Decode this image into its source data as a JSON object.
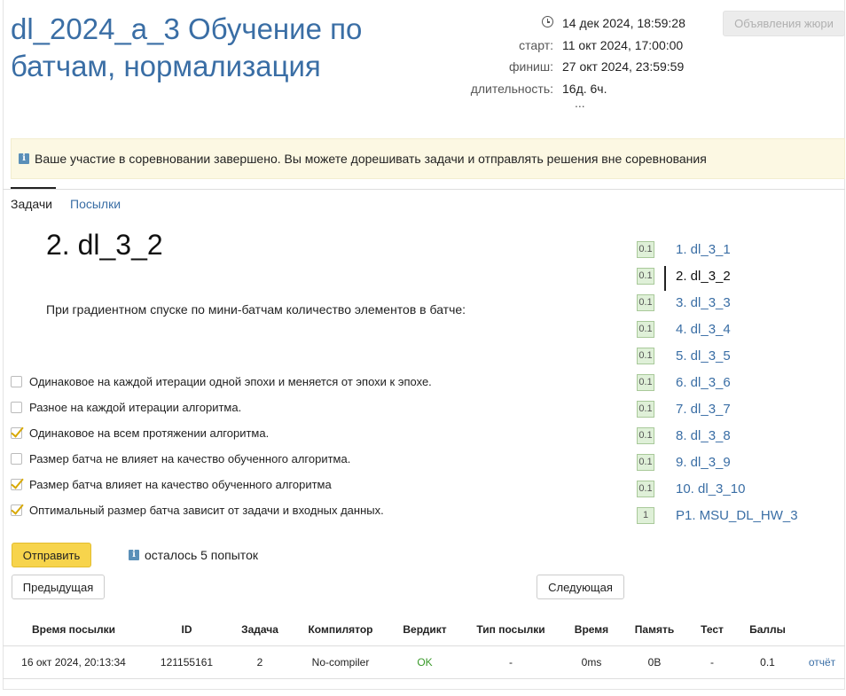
{
  "contest": {
    "title": "dl_2024_a_3 Обучение по батчам, нормализация",
    "clock_value": "14 дек 2024, 18:59:28",
    "start_label": "старт:",
    "start_value": "11 окт 2024, 17:00:00",
    "finish_label": "финиш:",
    "finish_value": "27 окт 2024, 23:59:59",
    "duration_label": "длительность:",
    "duration_value": "16д. 6ч.",
    "more": "...",
    "jury_button": "Объявления жюри"
  },
  "notice": {
    "icon": "i",
    "text": "Ваше участие в соревновании завершено. Вы можете дорешивать задачи и отправлять решения вне соревнования"
  },
  "tabs": [
    {
      "label": "Задачи",
      "active": true
    },
    {
      "label": "Посылки",
      "active": false
    }
  ],
  "problem": {
    "title": "2. dl_3_2",
    "statement": "При градиентном спуске по мини-батчам количество элементов в батче:",
    "options": [
      {
        "text": "Одинаковое на каждой итерации одной эпохи и меняется от эпохи к эпохе.",
        "checked": false
      },
      {
        "text": "Разное на каждой итерации алгоритма.",
        "checked": false
      },
      {
        "text": "Одинаковое на всем протяжении алгоритма.",
        "checked": true
      },
      {
        "text": "Размер батча не влияет на качество обученного алгоритма.",
        "checked": false
      },
      {
        "text": "Размер батча влияет на качество обученного алгоритма",
        "checked": true
      },
      {
        "text": "Оптимальный размер батча зависит от задачи и входных данных.",
        "checked": true
      }
    ],
    "submit_label": "Отправить",
    "attempts_text": "осталось 5 попыток",
    "prev_label": "Предыдущая",
    "next_label": "Следующая"
  },
  "problem_list": [
    {
      "score": "0.1",
      "label": "1. dl_3_1",
      "current": false
    },
    {
      "score": "0.1",
      "label": "2. dl_3_2",
      "current": true
    },
    {
      "score": "0.1",
      "label": "3. dl_3_3",
      "current": false
    },
    {
      "score": "0.1",
      "label": "4. dl_3_4",
      "current": false
    },
    {
      "score": "0.1",
      "label": "5. dl_3_5",
      "current": false
    },
    {
      "score": "0.1",
      "label": "6. dl_3_6",
      "current": false
    },
    {
      "score": "0.1",
      "label": "7. dl_3_7",
      "current": false
    },
    {
      "score": "0.1",
      "label": "8. dl_3_8",
      "current": false
    },
    {
      "score": "0.1",
      "label": "9. dl_3_9",
      "current": false
    },
    {
      "score": "0.1",
      "label": "10. dl_3_10",
      "current": false
    },
    {
      "score": "1",
      "label": "P1. MSU_DL_HW_3",
      "current": false
    }
  ],
  "submissions": {
    "headers": [
      "Время посылки",
      "ID",
      "Задача",
      "Компилятор",
      "Вердикт",
      "Тип посылки",
      "Время",
      "Память",
      "Тест",
      "Баллы",
      ""
    ],
    "rows": [
      [
        "16 окт 2024, 20:13:34",
        "121155161",
        "2",
        "No-compiler",
        "OK",
        "-",
        "0ms",
        "0B",
        "-",
        "0.1",
        "отчёт"
      ]
    ]
  },
  "colors": {
    "link": "#3a6ea5",
    "notice_bg": "#fcf8e3",
    "submit_bg": "#f7d44c",
    "score_bg": "#dff0d8",
    "verdict_ok": "#3a9a2a"
  }
}
